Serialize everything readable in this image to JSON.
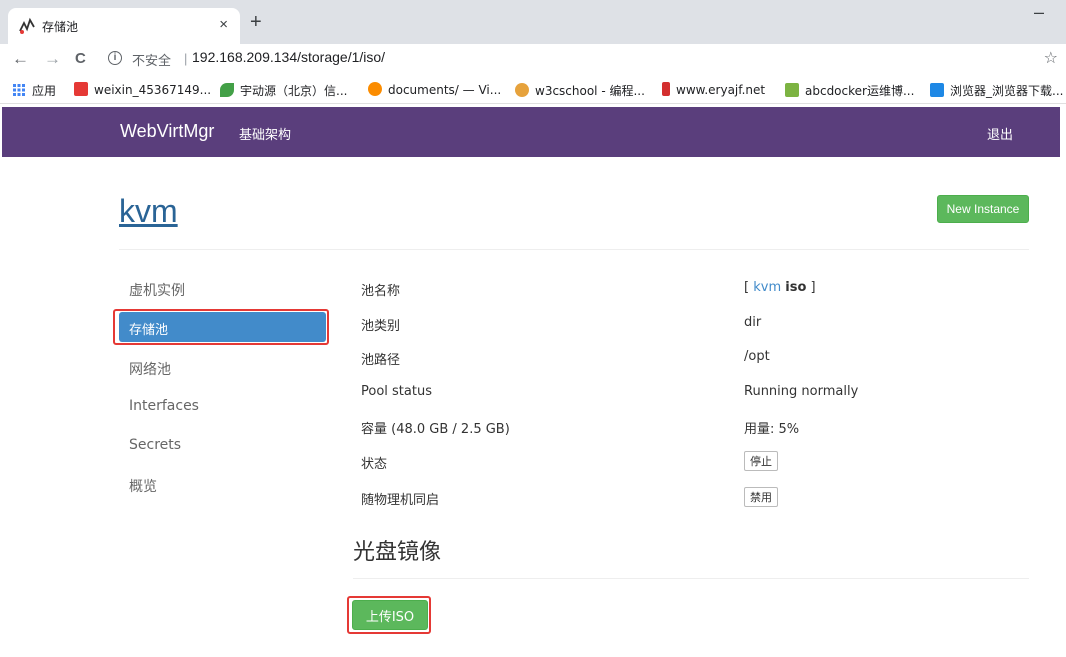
{
  "browser": {
    "tab_title": "存储池",
    "close_glyph": "×",
    "new_tab_glyph": "+",
    "minimize_glyph": "–",
    "nav": {
      "back": "←",
      "forward": "→",
      "reload": "C"
    },
    "insecure_label": "不安全",
    "url": "192.168.209.134/storage/1/iso/",
    "info_glyph": "i",
    "star_glyph": "☆",
    "bookmarks": [
      {
        "label": "应用",
        "color": "#4285f4"
      },
      {
        "label": "weixin_45367149...",
        "color": "#e53935"
      },
      {
        "label": "宇动源（北京）信...",
        "color": "#43a047"
      },
      {
        "label": "documents/ — Vi...",
        "color": "#fb8c00"
      },
      {
        "label": "w3cschool - 编程...",
        "color": "#e6a23c"
      },
      {
        "label": "www.eryajf.net",
        "color": "#d32f2f"
      },
      {
        "label": "abcdocker运维博...",
        "color": "#7cb342"
      },
      {
        "label": "浏览器_浏览器下载...",
        "color": "#1e88e5"
      }
    ]
  },
  "navbar": {
    "brand": "WebVirtMgr",
    "link": "基础架构",
    "logout": "退出"
  },
  "page": {
    "title": "kvm",
    "new_instance": "New Instance"
  },
  "sidebar": {
    "items": [
      "虚机实例",
      "存储池",
      "网络池",
      "Interfaces",
      "Secrets",
      "概览"
    ],
    "active_index": 1
  },
  "details": {
    "pool_name_label": "池名称",
    "pool_name_prefix": "[",
    "pool_name_link": "kvm",
    "pool_name_bold": "iso",
    "pool_name_suffix": "]",
    "pool_type_label": "池类别",
    "pool_type": "dir",
    "pool_path_label": "池路径",
    "pool_path": "/opt",
    "pool_status_label": "Pool status",
    "pool_status": "Running normally",
    "capacity_label": "容量 (48.0 GB / 2.5 GB)",
    "usage": "用量: 5%",
    "state_label": "状态",
    "stop_button": "停止",
    "autostart_label": "随物理机同启",
    "disable_button": "禁用"
  },
  "iso_section": {
    "title": "光盘镜像",
    "upload_button": "上传ISO"
  },
  "colors": {
    "navbar": "#5a3e7c",
    "accent_blue": "#428bca",
    "success_green": "#5cb85c",
    "highlight_red": "#e53935"
  }
}
